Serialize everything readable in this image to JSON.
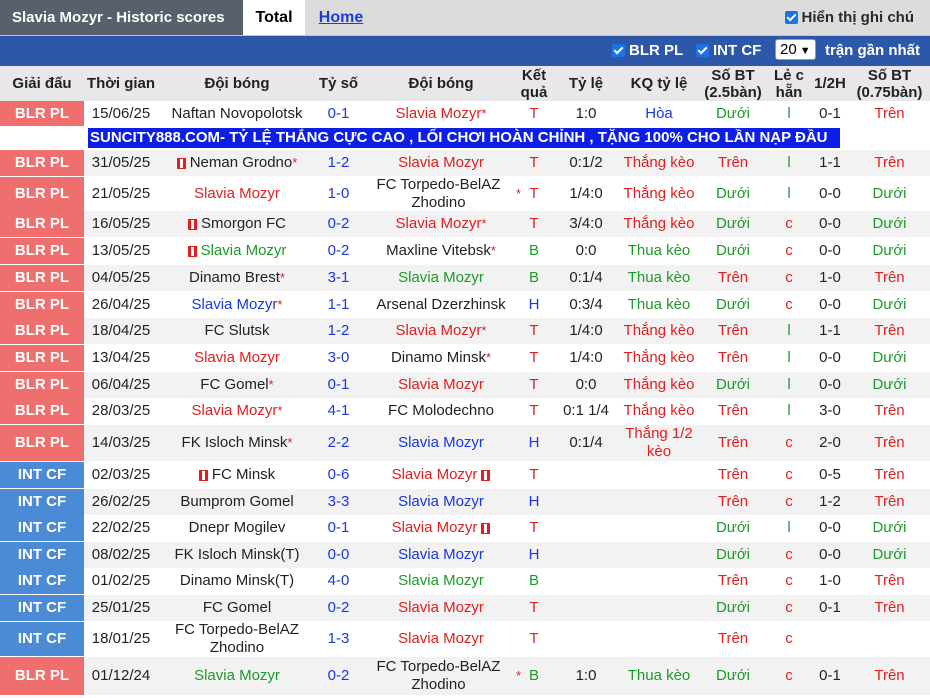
{
  "header": {
    "title": "Slavia Mozyr - Historic scores",
    "tab_total": "Total",
    "tab_home": "Home",
    "show_odds_label": "Hiển thị ghi chú"
  },
  "filters": {
    "blr_label": "BLR PL",
    "int_label": "INT CF",
    "count_value": "20",
    "recent_label": "trận gần nhất"
  },
  "columns": {
    "league": "Giải đấu",
    "time": "Thời gian",
    "home": "Đội bóng",
    "score": "Tỷ số",
    "away": "Đội bóng",
    "result": "Kết quả",
    "odds": "Tỷ lệ",
    "odds_result": "KQ tỷ lệ",
    "ou25": "Số BT (2.5bàn)",
    "oe": "Lẻ c hẵn",
    "half": "1/2H",
    "ou075": "Số BT (0.75bàn)"
  },
  "banner_text": "SUNCITY888.COM- TỶ LỆ THẮNG CỰC CAO , LỐI CHƠI HOÀN CHỈNH , TẶNG 100% CHO LẦN NẠP ĐẦU",
  "colors": {
    "blr": "#ef6f6f",
    "int": "#4b8bd6",
    "header_bar": "#2d57a8",
    "title_bg": "#57606b"
  },
  "matches": [
    {
      "league": "BLR PL",
      "date": "15/06/25",
      "home": "Naftan Novopolotsk",
      "score": "0-1",
      "away": "Slavia Mozyr",
      "result": "T",
      "odds": "1:0",
      "odds_result": "Hòa",
      "ou": "Dưới",
      "oe": "l",
      "half": "0-1",
      "ou2": "Trên"
    },
    {
      "league": "BLR PL",
      "date": "31/05/25",
      "home": "Neman Grodno",
      "score": "1-2",
      "away": "Slavia Mozyr",
      "result": "T",
      "odds": "0:1/2",
      "odds_result": "Thắng kèo",
      "ou": "Trên",
      "oe": "l",
      "half": "1-1",
      "ou2": "Trên"
    },
    {
      "league": "BLR PL",
      "date": "21/05/25",
      "home": "Slavia Mozyr",
      "score": "1-0",
      "away": "FC Torpedo-BelAZ Zhodino",
      "result": "T",
      "odds": "1/4:0",
      "odds_result": "Thắng kèo",
      "ou": "Dưới",
      "oe": "l",
      "half": "0-0",
      "ou2": "Dưới"
    },
    {
      "league": "BLR PL",
      "date": "16/05/25",
      "home": "Smorgon FC",
      "score": "0-2",
      "away": "Slavia Mozyr",
      "result": "T",
      "odds": "3/4:0",
      "odds_result": "Thắng kèo",
      "ou": "Dưới",
      "oe": "c",
      "half": "0-0",
      "ou2": "Dưới"
    },
    {
      "league": "BLR PL",
      "date": "13/05/25",
      "home": "Slavia Mozyr",
      "score": "0-2",
      "away": "Maxline Vitebsk",
      "result": "B",
      "odds": "0:0",
      "odds_result": "Thua kèo",
      "ou": "Dưới",
      "oe": "c",
      "half": "0-0",
      "ou2": "Dưới"
    },
    {
      "league": "BLR PL",
      "date": "04/05/25",
      "home": "Dinamo Brest",
      "score": "3-1",
      "away": "Slavia Mozyr",
      "result": "B",
      "odds": "0:1/4",
      "odds_result": "Thua kèo",
      "ou": "Trên",
      "oe": "c",
      "half": "1-0",
      "ou2": "Trên"
    },
    {
      "league": "BLR PL",
      "date": "26/04/25",
      "home": "Slavia Mozyr",
      "score": "1-1",
      "away": "Arsenal Dzerzhinsk",
      "result": "H",
      "odds": "0:3/4",
      "odds_result": "Thua kèo",
      "ou": "Dưới",
      "oe": "c",
      "half": "0-0",
      "ou2": "Dưới"
    },
    {
      "league": "BLR PL",
      "date": "18/04/25",
      "home": "FC Slutsk",
      "score": "1-2",
      "away": "Slavia Mozyr",
      "result": "T",
      "odds": "1/4:0",
      "odds_result": "Thắng kèo",
      "ou": "Trên",
      "oe": "l",
      "half": "1-1",
      "ou2": "Trên"
    },
    {
      "league": "BLR PL",
      "date": "13/04/25",
      "home": "Slavia Mozyr",
      "score": "3-0",
      "away": "Dinamo Minsk",
      "result": "T",
      "odds": "1/4:0",
      "odds_result": "Thắng kèo",
      "ou": "Trên",
      "oe": "l",
      "half": "0-0",
      "ou2": "Dưới"
    },
    {
      "league": "BLR PL",
      "date": "06/04/25",
      "home": "FC Gomel",
      "score": "0-1",
      "away": "Slavia Mozyr",
      "result": "T",
      "odds": "0:0",
      "odds_result": "Thắng kèo",
      "ou": "Dưới",
      "oe": "l",
      "half": "0-0",
      "ou2": "Dưới"
    },
    {
      "league": "BLR PL",
      "date": "28/03/25",
      "home": "Slavia Mozyr",
      "score": "4-1",
      "away": "FC Molodechno",
      "result": "T",
      "odds": "0:1 1/4",
      "odds_result": "Thắng kèo",
      "ou": "Trên",
      "oe": "l",
      "half": "3-0",
      "ou2": "Trên"
    },
    {
      "league": "BLR PL",
      "date": "14/03/25",
      "home": "FK Isloch Minsk",
      "score": "2-2",
      "away": "Slavia Mozyr",
      "result": "H",
      "odds": "0:1/4",
      "odds_result": "Thắng 1/2 kèo",
      "ou": "Trên",
      "oe": "c",
      "half": "2-0",
      "ou2": "Trên"
    },
    {
      "league": "INT CF",
      "date": "02/03/25",
      "home": "FC Minsk",
      "score": "0-6",
      "away": "Slavia Mozyr",
      "result": "T",
      "odds": "",
      "odds_result": "",
      "ou": "Trên",
      "oe": "c",
      "half": "0-5",
      "ou2": "Trên"
    },
    {
      "league": "INT CF",
      "date": "26/02/25",
      "home": "Bumprom Gomel",
      "score": "3-3",
      "away": "Slavia Mozyr",
      "result": "H",
      "odds": "",
      "odds_result": "",
      "ou": "Trên",
      "oe": "c",
      "half": "1-2",
      "ou2": "Trên"
    },
    {
      "league": "INT CF",
      "date": "22/02/25",
      "home": "Dnepr Mogilev",
      "score": "0-1",
      "away": "Slavia Mozyr",
      "result": "T",
      "odds": "",
      "odds_result": "",
      "ou": "Dưới",
      "oe": "l",
      "half": "0-0",
      "ou2": "Dưới"
    },
    {
      "league": "INT CF",
      "date": "08/02/25",
      "home": "FK Isloch Minsk(T)",
      "score": "0-0",
      "away": "Slavia Mozyr",
      "result": "H",
      "odds": "",
      "odds_result": "",
      "ou": "Dưới",
      "oe": "c",
      "half": "0-0",
      "ou2": "Dưới"
    },
    {
      "league": "INT CF",
      "date": "01/02/25",
      "home": "Dinamo Minsk(T)",
      "score": "4-0",
      "away": "Slavia Mozyr",
      "result": "B",
      "odds": "",
      "odds_result": "",
      "ou": "Trên",
      "oe": "c",
      "half": "1-0",
      "ou2": "Trên"
    },
    {
      "league": "INT CF",
      "date": "25/01/25",
      "home": "FC Gomel",
      "score": "0-2",
      "away": "Slavia Mozyr",
      "result": "T",
      "odds": "",
      "odds_result": "",
      "ou": "Dưới",
      "oe": "c",
      "half": "0-1",
      "ou2": "Trên"
    },
    {
      "league": "INT CF",
      "date": "18/01/25",
      "home": "FC Torpedo-BelAZ Zhodino",
      "score": "1-3",
      "away": "Slavia Mozyr",
      "result": "T",
      "odds": "",
      "odds_result": "",
      "ou": "Trên",
      "oe": "c",
      "half": "",
      "ou2": ""
    },
    {
      "league": "BLR PL",
      "date": "01/12/24",
      "home": "Slavia Mozyr",
      "score": "0-2",
      "away": "FC Torpedo-BelAZ Zhodino",
      "result": "B",
      "odds": "1:0",
      "odds_result": "Thua kèo",
      "ou": "Dưới",
      "oe": "c",
      "half": "0-1",
      "ou2": "Trên"
    }
  ]
}
